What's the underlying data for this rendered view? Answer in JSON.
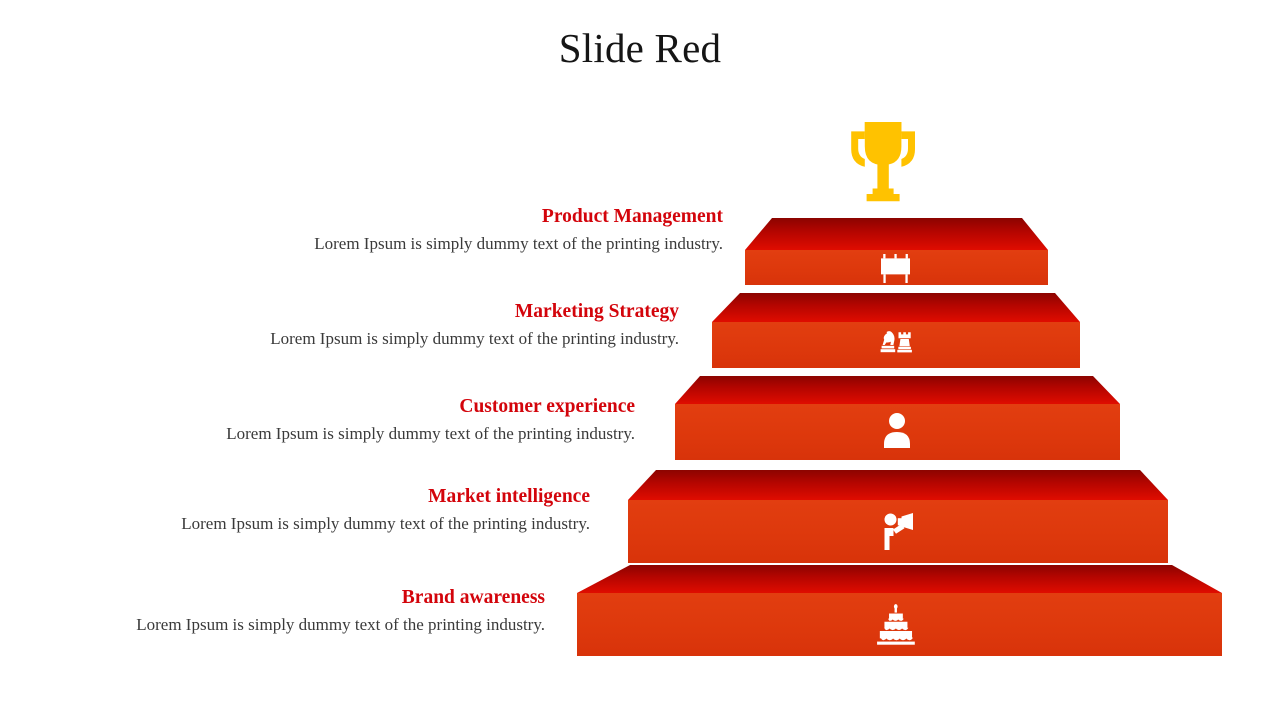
{
  "slide": {
    "title": "Slide Red",
    "background_color": "#ffffff",
    "accent_heading_color": "#d3040b",
    "body_text_color": "#3a3a3a",
    "step_top_color": "#c20700",
    "step_top_color_dark": "#8e0400",
    "step_front_color": "#df3a0d",
    "trophy_color": "#ffc200",
    "icon_color": "#ffffff"
  },
  "trophy": {
    "icon": "trophy-icon",
    "color": "#ffc200"
  },
  "steps": [
    {
      "index": 5,
      "level": "top",
      "heading": "Product Management",
      "description": "Lorem Ipsum is simply dummy text of the printing industry.",
      "icon": "billboard-icon"
    },
    {
      "index": 4,
      "level": "fourth",
      "heading": "Marketing Strategy",
      "description": "Lorem Ipsum is simply dummy text of the printing industry.",
      "icon": "chess-pieces-icon"
    },
    {
      "index": 3,
      "level": "third",
      "heading": "Customer experience",
      "description": "Lorem Ipsum is simply dummy text of the printing industry.",
      "icon": "person-icon"
    },
    {
      "index": 2,
      "level": "second",
      "heading": "Market intelligence",
      "description": "Lorem Ipsum is simply dummy text of the printing industry.",
      "icon": "person-megaphone-icon"
    },
    {
      "index": 1,
      "level": "bottom",
      "heading": "Brand awareness",
      "description": "Lorem Ipsum is simply dummy text of the printing industry.",
      "icon": "tiered-cake-icon"
    }
  ]
}
